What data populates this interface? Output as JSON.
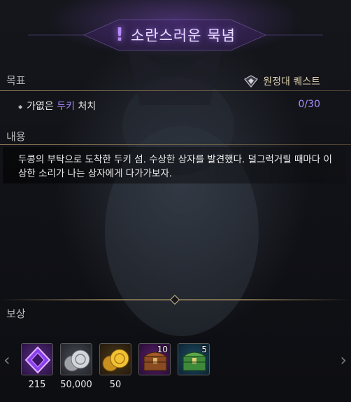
{
  "title": {
    "icon": "exclamation-icon",
    "text": "소란스러운 묵념"
  },
  "objective_section": {
    "label": "목표",
    "quest_type": "원정대 퀘스트",
    "quest_type_icon": "expedition-crest-icon",
    "objective_prefix": "가엾은",
    "objective_highlight": "두키",
    "objective_suffix": "처치",
    "progress": "0/30"
  },
  "content_section": {
    "label": "내용",
    "description": "두콩의 부탁으로 도착한 두키 섬. 수상한 상자를 발견했다. 덜그럭거릴 때마다 이상한 소리가 나는 상자에게 다가가보자."
  },
  "rewards_section": {
    "label": "보상",
    "items": [
      {
        "icon": "purple-crystal-icon",
        "amount": "215",
        "badge": ""
      },
      {
        "icon": "silver-coins-icon",
        "amount": "50,000",
        "badge": ""
      },
      {
        "icon": "gold-coins-icon",
        "amount": "50",
        "badge": ""
      },
      {
        "icon": "wooden-chest-icon",
        "amount": "",
        "badge": "10"
      },
      {
        "icon": "green-chest-icon",
        "amount": "",
        "badge": "5"
      }
    ]
  },
  "colors": {
    "accent_purple": "#a98cff",
    "title_glow": "#b88aff",
    "gold_rule": "#9a8660"
  }
}
